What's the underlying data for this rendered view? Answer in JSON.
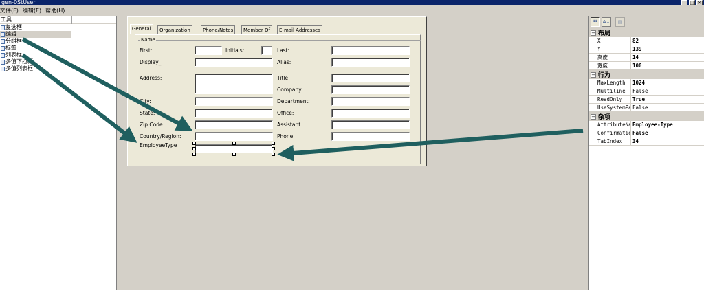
{
  "window": {
    "title": "gen-0StUser"
  },
  "menu": [
    "文件(F)",
    "编辑(E)",
    "帮助(H)"
  ],
  "toolbox": {
    "header": "工具",
    "items": [
      "复选框",
      "编辑",
      "分组框",
      "标签",
      "列表框",
      "多值下拉框",
      "多值列表框"
    ],
    "selected_index": 1
  },
  "form": {
    "tabs": [
      "General",
      "Organization",
      "Phone/Notes",
      "Member Of",
      "E-mail Addresses"
    ],
    "active_tab": "General",
    "group_title": "Name",
    "labels": {
      "first": "First:",
      "initials": "Initials:",
      "last": "Last:",
      "display": "Display_",
      "alias": "Alias:",
      "address": "Address:",
      "title": "Title:",
      "company": "Company:",
      "city": "City:",
      "department": "Department:",
      "state": "State:",
      "office": "Office:",
      "zip": "Zip Code:",
      "assistant": "Assistant:",
      "country": "Country/Region:",
      "phone": "Phone:",
      "employee_type": "EmployeeType"
    }
  },
  "properties": {
    "categories": [
      {
        "name": "布局",
        "rows": [
          {
            "name": "X",
            "value": "82"
          },
          {
            "name": "Y",
            "value": "139"
          },
          {
            "name": "高度",
            "value": "14"
          },
          {
            "name": "宽度",
            "value": "100"
          }
        ]
      },
      {
        "name": "行为",
        "rows": [
          {
            "name": "MaxLength",
            "value": "1024"
          },
          {
            "name": "Multiline",
            "value": "False"
          },
          {
            "name": "ReadOnly",
            "value": "True"
          },
          {
            "name": "UseSystemPass",
            "value": "False"
          }
        ]
      },
      {
        "name": "杂项",
        "rows": [
          {
            "name": "AttributeName",
            "value": "Employee-Type"
          },
          {
            "name": "ConfirmationF",
            "value": "False"
          },
          {
            "name": "TabIndex",
            "value": "34"
          }
        ]
      }
    ]
  },
  "colors": {
    "arrow": "#1f5f5f",
    "title_bar": "#0a246a"
  }
}
